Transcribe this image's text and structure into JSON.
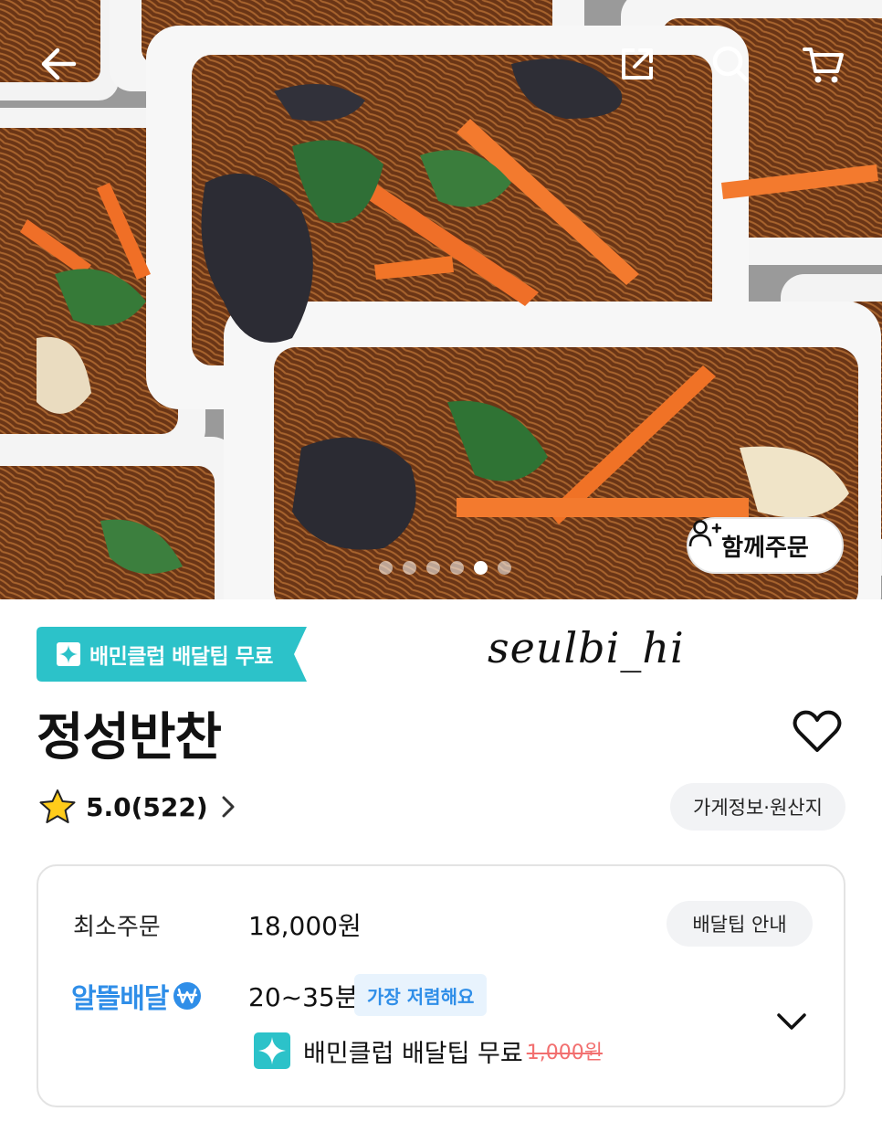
{
  "header": {
    "back_icon": "arrow-left-icon",
    "share_icon": "share-icon",
    "search_icon": "search-icon",
    "cart_icon": "cart-icon"
  },
  "hero": {
    "image_subject": "japchae-containers-photo",
    "slide_count": 6,
    "active_slide": 5,
    "group_order_label": "함께주문",
    "group_order_icon": "person-add-icon"
  },
  "store": {
    "club_badge": "배민클럽 배달팁 무료",
    "watermark": "seulbi_hi",
    "name": "정성반찬",
    "rating": "5.0(522)",
    "info_chip": "가게정보·원산지"
  },
  "delivery": {
    "min_order_label": "최소주문",
    "min_order_value": "18,000원",
    "tip_info_label": "배달팁 안내",
    "service_name": "알뜰배달",
    "time": "20~35분",
    "cheap_tag": "가장 저렴해요",
    "club_text": "배민클럽 배달팁 무료",
    "original_fee": "1,000원"
  },
  "colors": {
    "club_teal": "#2cc2c9",
    "alddeul_blue": "#2f8ee8",
    "strike_red": "#f26f6f",
    "star_yellow": "#ffcc1a"
  }
}
